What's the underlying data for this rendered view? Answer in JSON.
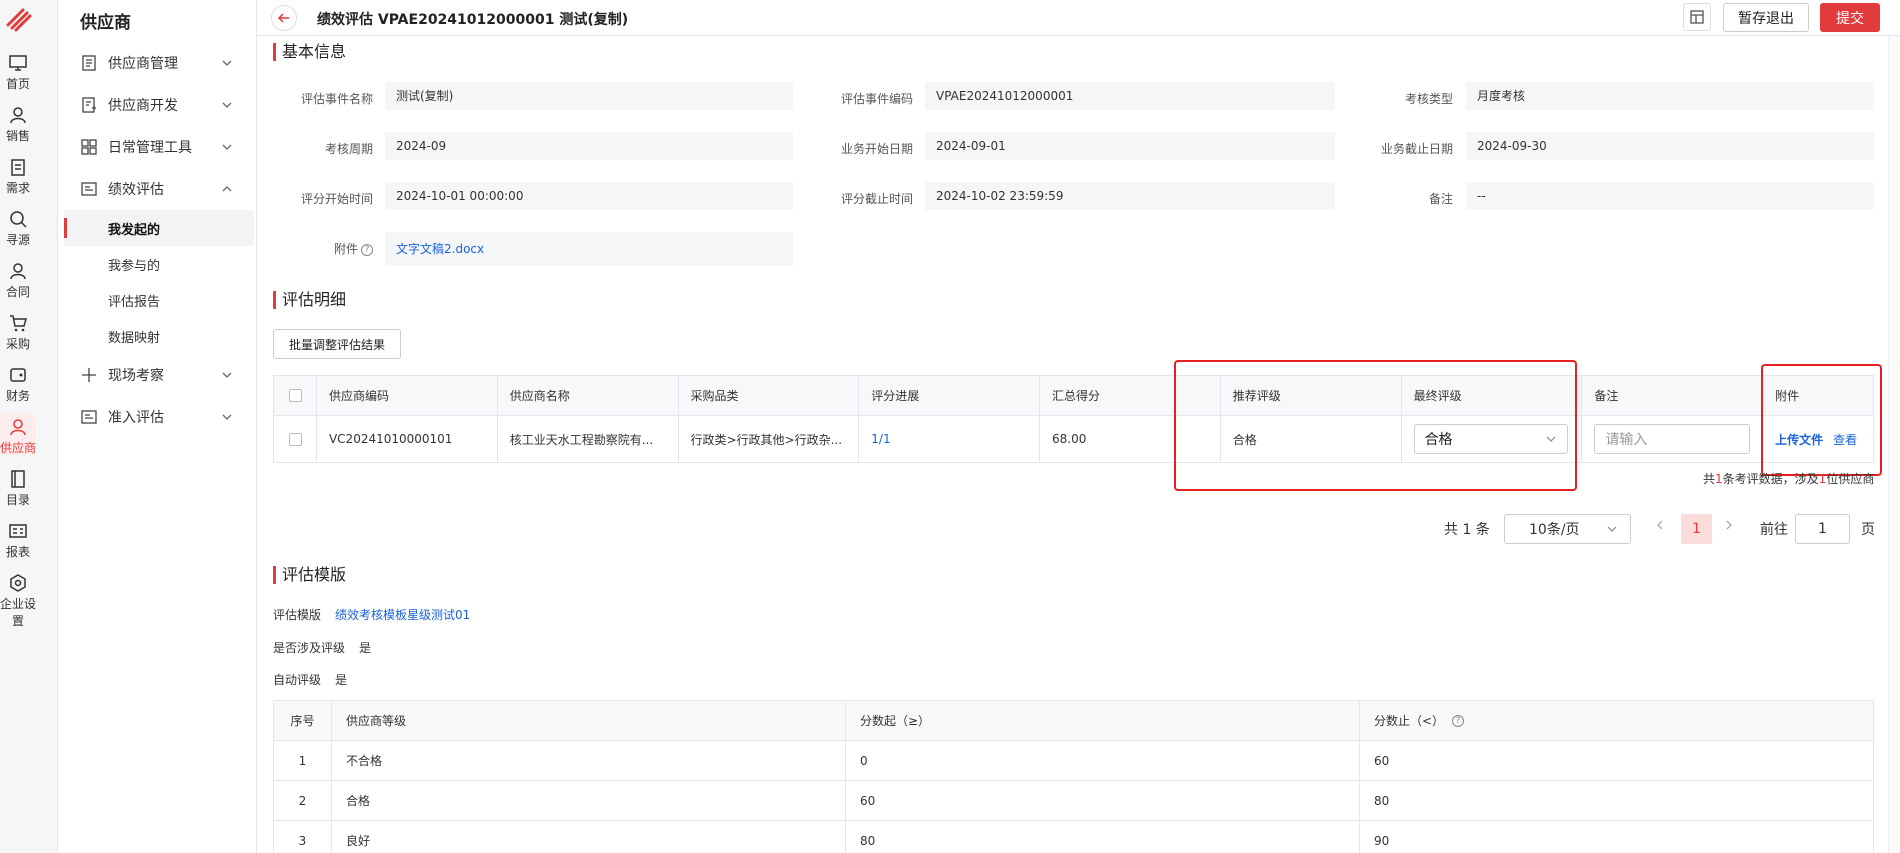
{
  "rail": {
    "items": [
      {
        "label": "首页",
        "icon": "monitor-icon"
      },
      {
        "label": "销售",
        "icon": "user-icon"
      },
      {
        "label": "需求",
        "icon": "clipboard-icon"
      },
      {
        "label": "寻源",
        "icon": "search-icon"
      },
      {
        "label": "合同",
        "icon": "user-icon"
      },
      {
        "label": "采购",
        "icon": "cart-icon"
      },
      {
        "label": "财务",
        "icon": "wallet-icon"
      },
      {
        "label": "供应商",
        "icon": "supplier-icon"
      },
      {
        "label": "目录",
        "icon": "book-icon"
      },
      {
        "label": "报表",
        "icon": "report-icon"
      },
      {
        "label": "企业设置",
        "icon": "settings-icon"
      }
    ]
  },
  "sidebar": {
    "title": "供应商",
    "menus": [
      {
        "label": "供应商管理"
      },
      {
        "label": "供应商开发"
      },
      {
        "label": "日常管理工具"
      },
      {
        "label": "绩效评估"
      },
      {
        "label": "现场考察"
      },
      {
        "label": "准入评估"
      }
    ],
    "subs": [
      {
        "label": "我发起的"
      },
      {
        "label": "我参与的"
      },
      {
        "label": "评估报告"
      },
      {
        "label": "数据映射"
      }
    ]
  },
  "header": {
    "title": "绩效评估 VPAE20241012000001 测试(复制)",
    "save_label": "暂存退出",
    "submit_label": "提交"
  },
  "basic": {
    "section_title": "基本信息",
    "fields": [
      {
        "label": "评估事件名称",
        "value": "测试(复制)"
      },
      {
        "label": "评估事件编码",
        "value": "VPAE20241012000001"
      },
      {
        "label": "考核类型",
        "value": "月度考核"
      },
      {
        "label": "考核周期",
        "value": "2024-09"
      },
      {
        "label": "业务开始日期",
        "value": "2024-09-01"
      },
      {
        "label": "业务截止日期",
        "value": "2024-09-30"
      },
      {
        "label": "评分开始时间",
        "value": "2024-10-01 00:00:00"
      },
      {
        "label": "评分截止时间",
        "value": "2024-10-02 23:59:59"
      },
      {
        "label": "备注",
        "value": "--"
      }
    ],
    "attachment_label": "附件",
    "attachment_value": "文字文稿2.docx"
  },
  "detail": {
    "section_title": "评估明细",
    "batch_label": "批量调整评估结果",
    "columns": [
      "供应商编码",
      "供应商名称",
      "采购品类",
      "评分进展",
      "汇总得分",
      "推荐评级",
      "最终评级",
      "备注",
      "附件"
    ],
    "row": {
      "code": "VC20241010000101",
      "name": "核工业天水工程勘察院有...",
      "category": "行政类>行政其他>行政杂...",
      "progress": "1/1",
      "score": "68.00",
      "recommended": "合格",
      "final": "合格",
      "remark_placeholder": "请输入",
      "upload_label": "上传文件",
      "view_label": "查看"
    },
    "note_prefix": "共",
    "note_n1": "1",
    "note_mid": "条考评数据，涉及",
    "note_n2": "1",
    "note_suffix": "位供应商"
  },
  "pagination": {
    "total": "共 1 条",
    "page_size": "10条/页",
    "current": "1",
    "goto_label": "前往",
    "goto_value": "1",
    "page_label": "页"
  },
  "template": {
    "section_title": "评估模版",
    "template_label": "评估模版",
    "template_value": "绩效考核模板星级测试01",
    "rating_label": "是否涉及评级",
    "rating_value": "是",
    "auto_label": "自动评级",
    "auto_value": "是",
    "columns": [
      "序号",
      "供应商等级",
      "分数起（≥）",
      "分数止（<）"
    ],
    "rows": [
      {
        "no": "1",
        "grade": "不合格",
        "from": "0",
        "to": "60"
      },
      {
        "no": "2",
        "grade": "合格",
        "from": "60",
        "to": "80"
      },
      {
        "no": "3",
        "grade": "良好",
        "from": "80",
        "to": "90"
      }
    ]
  },
  "colors": {
    "accent": "#e23b3b",
    "link": "#1a63d8",
    "highlight": "#e62020"
  }
}
